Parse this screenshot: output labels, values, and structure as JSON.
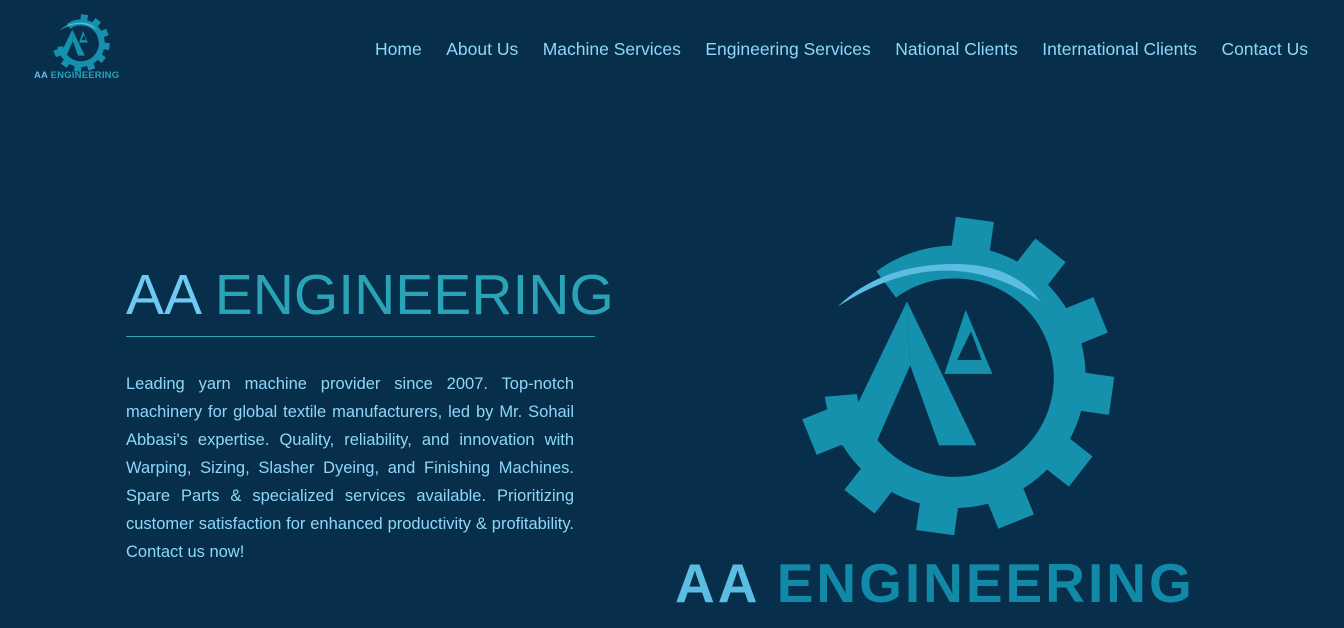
{
  "brand": {
    "logo_aa": "AA",
    "logo_engineering": "ENGINEERING",
    "colors": {
      "background": "#072e4b",
      "accent_light": "#6fcaf3",
      "accent_teal": "#1591ad"
    }
  },
  "nav": {
    "items": [
      {
        "label": "Home"
      },
      {
        "label": "About Us"
      },
      {
        "label": "Machine Services"
      },
      {
        "label": "Engineering Services"
      },
      {
        "label": "National Clients"
      },
      {
        "label": "International Clients"
      },
      {
        "label": "Contact Us"
      }
    ]
  },
  "hero": {
    "title_part1": "AA",
    "title_part2": "ENGINEERING",
    "description": "Leading yarn machine provider since 2007. Top-notch machinery for global textile manufacturers, led by Mr. Sohail Abbasi's expertise. Quality, reliability, and innovation with Warping, Sizing, Slasher Dyeing, and Finishing Machines. Spare Parts & specialized services available. Prioritizing customer satisfaction for enhanced productivity & profitability. Contact us now!"
  },
  "icons": {
    "logo": "gear-logo-icon"
  }
}
